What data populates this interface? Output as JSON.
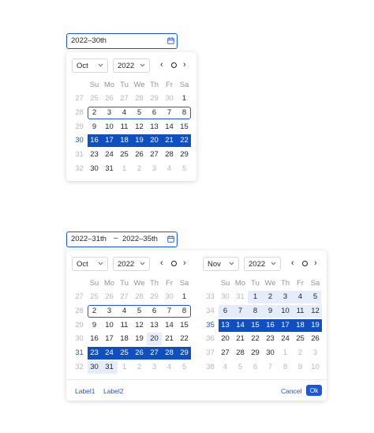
{
  "picker1": {
    "input_value": "2022–30th",
    "month": "Oct",
    "year": "2022",
    "nav_prev": "‹",
    "nav_next": "›",
    "weekdays": [
      "Su",
      "Mo",
      "Tu",
      "We",
      "Th",
      "Fr",
      "Sa"
    ],
    "weeks": [
      {
        "wk": "27",
        "days": [
          "25",
          "26",
          "27",
          "28",
          "29",
          "30",
          "1"
        ]
      },
      {
        "wk": "28",
        "days": [
          "2",
          "3",
          "4",
          "5",
          "6",
          "7",
          "8"
        ]
      },
      {
        "wk": "29",
        "days": [
          "9",
          "10",
          "11",
          "12",
          "13",
          "14",
          "15"
        ]
      },
      {
        "wk": "30",
        "days": [
          "16",
          "17",
          "18",
          "19",
          "20",
          "21",
          "22"
        ]
      },
      {
        "wk": "31",
        "days": [
          "23",
          "24",
          "25",
          "26",
          "27",
          "28",
          "29"
        ]
      },
      {
        "wk": "32",
        "days": [
          "30",
          "31",
          "1",
          "2",
          "3",
          "4",
          "5"
        ]
      }
    ],
    "selected_week": "30"
  },
  "picker2": {
    "input_start": "2022–31th",
    "separator": "–",
    "input_end": "2022–35th",
    "left": {
      "month": "Oct",
      "year": "2022",
      "weeks": [
        {
          "wk": "27",
          "days": [
            "25",
            "26",
            "27",
            "28",
            "29",
            "30",
            "1"
          ]
        },
        {
          "wk": "28",
          "days": [
            "2",
            "3",
            "4",
            "5",
            "6",
            "7",
            "8"
          ]
        },
        {
          "wk": "29",
          "days": [
            "9",
            "10",
            "11",
            "12",
            "13",
            "14",
            "15"
          ]
        },
        {
          "wk": "30",
          "days": [
            "16",
            "17",
            "18",
            "19",
            "20",
            "21",
            "22"
          ]
        },
        {
          "wk": "31",
          "days": [
            "23",
            "24",
            "25",
            "26",
            "27",
            "28",
            "29"
          ]
        },
        {
          "wk": "32",
          "days": [
            "30",
            "31",
            "1",
            "2",
            "3",
            "4",
            "5"
          ]
        }
      ]
    },
    "right": {
      "month": "Nov",
      "year": "2022",
      "weeks": [
        {
          "wk": "33",
          "days": [
            "30",
            "31",
            "1",
            "2",
            "3",
            "4",
            "5"
          ]
        },
        {
          "wk": "34",
          "days": [
            "6",
            "7",
            "8",
            "9",
            "10",
            "11",
            "12"
          ]
        },
        {
          "wk": "35",
          "days": [
            "13",
            "14",
            "15",
            "16",
            "17",
            "18",
            "19"
          ]
        },
        {
          "wk": "36",
          "days": [
            "20",
            "21",
            "22",
            "23",
            "24",
            "25",
            "26"
          ]
        },
        {
          "wk": "37",
          "days": [
            "27",
            "28",
            "29",
            "30",
            "1",
            "2",
            "3"
          ]
        },
        {
          "wk": "38",
          "days": [
            "4",
            "5",
            "6",
            "7",
            "8",
            "9",
            "10"
          ]
        }
      ]
    },
    "weekdays": [
      "Su",
      "Mo",
      "Tu",
      "We",
      "Th",
      "Fr",
      "Sa"
    ],
    "nav_prev": "‹",
    "nav_next": "›",
    "footer": {
      "label1": "Label1",
      "label2": "Label2",
      "cancel": "Cancel",
      "ok": "Ok"
    },
    "start_week": "31",
    "end_week": "35"
  },
  "colors": {
    "accent": "#1b57d6",
    "selected": "#0f4fc2",
    "range": "#e5edfb"
  }
}
